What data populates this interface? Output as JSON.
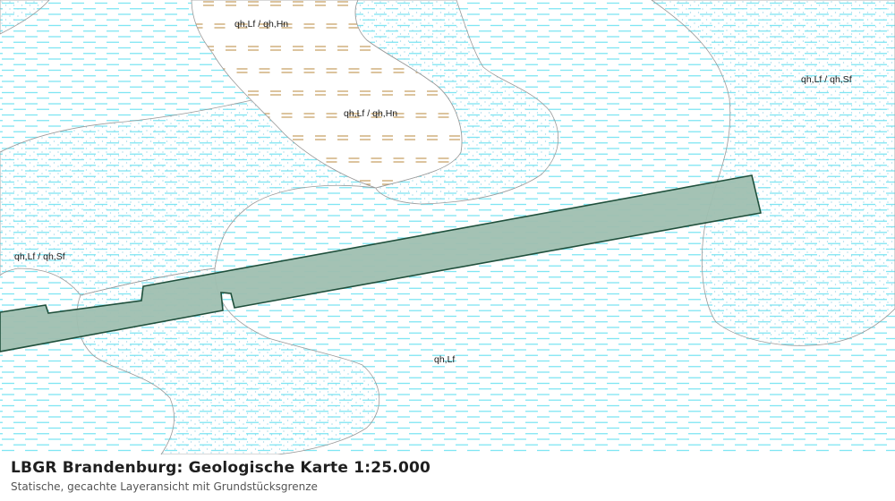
{
  "map": {
    "colors": {
      "background": "#ffffff",
      "water_dash": "#7fe6f3",
      "dot": "#8fd0e3",
      "boundary": "#9a9a9a",
      "peat_dash": "#c9a46a",
      "parcel_fill": "#9fbfb0",
      "parcel_stroke": "#1f4f3b"
    },
    "labels": [
      {
        "id": "label-1",
        "text": "qh,Lf / qh,Hn"
      },
      {
        "id": "label-2",
        "text": "qh,Lf / qh,Hn"
      },
      {
        "id": "label-3",
        "text": "qh,Lf / qh,Sf"
      },
      {
        "id": "label-4",
        "text": "qh,Lf / qh,Sf"
      },
      {
        "id": "label-5",
        "text": "qh,Lf"
      }
    ]
  },
  "caption": {
    "title": "LBGR Brandenburg: Geologische Karte 1:25.000",
    "subtitle": "Statische, gecachte Layeransicht mit Grundstücksgrenze"
  }
}
